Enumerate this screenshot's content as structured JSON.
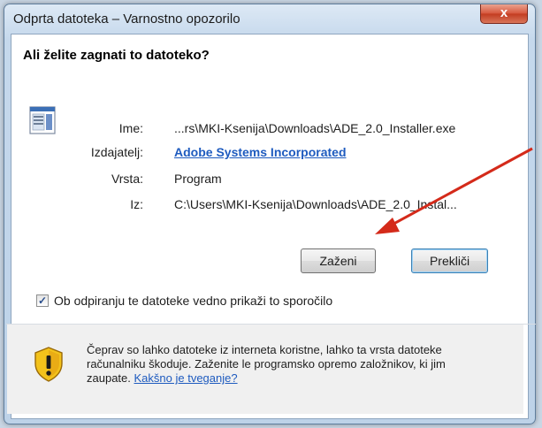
{
  "window": {
    "title": "Odprta datoteka – Varnostno opozorilo",
    "close_label": "x"
  },
  "dialog": {
    "heading": "Ali želite zagnati to datoteko?",
    "fields": {
      "name_label": "Ime:",
      "name_value": "...rs\\MKI-Ksenija\\Downloads\\ADE_2.0_Installer.exe",
      "publisher_label": "Izdajatelj:",
      "publisher_value": "Adobe Systems Incorporated",
      "type_label": "Vrsta:",
      "type_value": "Program",
      "from_label": "Iz:",
      "from_value": "C:\\Users\\MKI-Ksenija\\Downloads\\ADE_2.0_Instal..."
    },
    "buttons": {
      "run": "Zaženi",
      "cancel": "Prekliči"
    },
    "checkbox": {
      "label": "Ob odpiranju te datoteke vedno prikaži to sporočilo",
      "checked": true
    },
    "warning": {
      "text": "Čeprav so lahko datoteke iz interneta koristne, lahko ta vrsta datoteke računalniku škoduje. Zaženite le programsko opremo založnikov, ki jim zaupate.",
      "link": "Kakšno je tveganje?"
    }
  },
  "colors": {
    "link": "#1e5bbf",
    "annotation_arrow": "#d42a1a"
  },
  "icons": {
    "file": "application-file-icon",
    "warning": "security-shield-warning-icon",
    "close": "close-icon"
  }
}
